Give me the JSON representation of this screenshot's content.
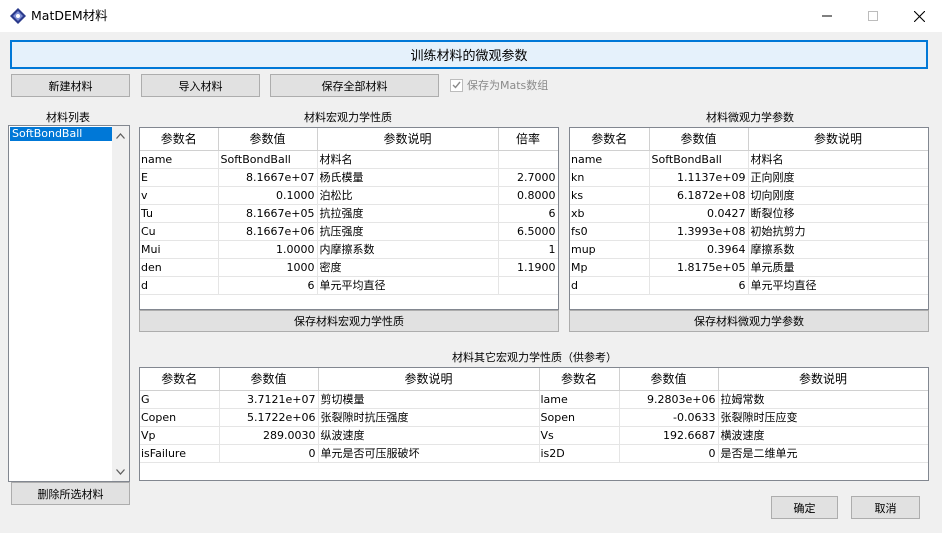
{
  "window": {
    "title": "MatDEM材料"
  },
  "toolbar": {
    "train_button": "训练材料的微观参数",
    "new_material": "新建材料",
    "import_material": "导入材料",
    "save_all": "保存全部材料",
    "save_as_mats_label": "保存为Mats数组",
    "save_as_mats_checked": true,
    "delete_selected": "删除所选材料"
  },
  "material_list": {
    "title": "材料列表",
    "items": [
      "SoftBondBall"
    ],
    "selected": 0
  },
  "macro": {
    "title": "材料宏观力学性质",
    "headers": [
      "参数名",
      "参数值",
      "参数说明",
      "倍率"
    ],
    "rows": [
      [
        "name",
        "SoftBondBall",
        "材料名",
        ""
      ],
      [
        "E",
        "8.1667e+07",
        "杨氏模量",
        "2.7000"
      ],
      [
        "v",
        "0.1000",
        "泊松比",
        "0.8000"
      ],
      [
        "Tu",
        "8.1667e+05",
        "抗拉强度",
        "6"
      ],
      [
        "Cu",
        "8.1667e+06",
        "抗压强度",
        "6.5000"
      ],
      [
        "Mui",
        "1.0000",
        "内摩擦系数",
        "1"
      ],
      [
        "den",
        "1000",
        "密度",
        "1.1900"
      ],
      [
        "d",
        "6",
        "单元平均直径",
        ""
      ]
    ],
    "save_button": "保存材料宏观力学性质"
  },
  "micro": {
    "title": "材料微观力学参数",
    "headers": [
      "参数名",
      "参数值",
      "参数说明"
    ],
    "rows": [
      [
        "name",
        "SoftBondBall",
        "材料名"
      ],
      [
        "kn",
        "1.1137e+09",
        "正向刚度"
      ],
      [
        "ks",
        "6.1872e+08",
        "切向刚度"
      ],
      [
        "xb",
        "0.0427",
        "断裂位移"
      ],
      [
        "fs0",
        "1.3993e+08",
        "初始抗剪力"
      ],
      [
        "mup",
        "0.3964",
        "摩擦系数"
      ],
      [
        "Mp",
        "1.8175e+05",
        "单元质量"
      ],
      [
        "d",
        "6",
        "单元平均直径"
      ]
    ],
    "save_button": "保存材料微观力学参数"
  },
  "other": {
    "title": "材料其它宏观力学性质（供参考）",
    "headers": [
      "参数名",
      "参数值",
      "参数说明",
      "参数名",
      "参数值",
      "参数说明"
    ],
    "rows": [
      [
        "G",
        "3.7121e+07",
        "剪切模量",
        "lame",
        "9.2803e+06",
        "拉姆常数"
      ],
      [
        "Copen",
        "5.1722e+06",
        "张裂隙时抗压强度",
        "Sopen",
        "-0.0633",
        "张裂隙时压应变"
      ],
      [
        "Vp",
        "289.0030",
        "纵波速度",
        "Vs",
        "192.6687",
        "横波速度"
      ],
      [
        "isFailure",
        "0",
        "单元是否可压服破坏",
        "is2D",
        "0",
        "是否是二维单元"
      ]
    ]
  },
  "footer": {
    "ok": "确定",
    "cancel": "取消"
  },
  "colors": {
    "accent": "#0078d7",
    "selection": "#0078d7"
  }
}
